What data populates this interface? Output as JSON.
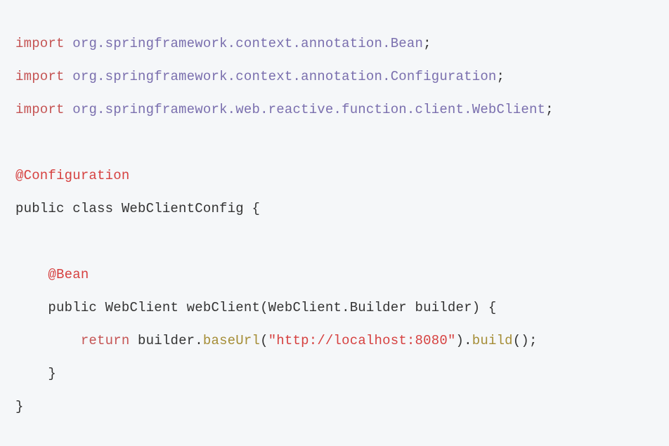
{
  "code": {
    "import_kw": "import",
    "import1_pkg": "org.springframework.context.annotation.Bean",
    "import2_pkg": "org.springframework.context.annotation.Configuration",
    "import3_pkg": "org.springframework.web.reactive.function.client.WebClient",
    "semicolon": ";",
    "anno_configuration": "@Configuration",
    "class_decl": "public class WebClientConfig {",
    "anno_bean": "@Bean",
    "method_decl": "public WebClient webClient(WebClient.Builder builder) {",
    "return_kw": "return",
    "builder_obj": " builder.",
    "fn_baseUrl": "baseUrl",
    "paren_open": "(",
    "str_url": "\"http://localhost:8080\"",
    "paren_close_dot": ").",
    "fn_build": "build",
    "tail": "();",
    "brace_close": "}"
  }
}
